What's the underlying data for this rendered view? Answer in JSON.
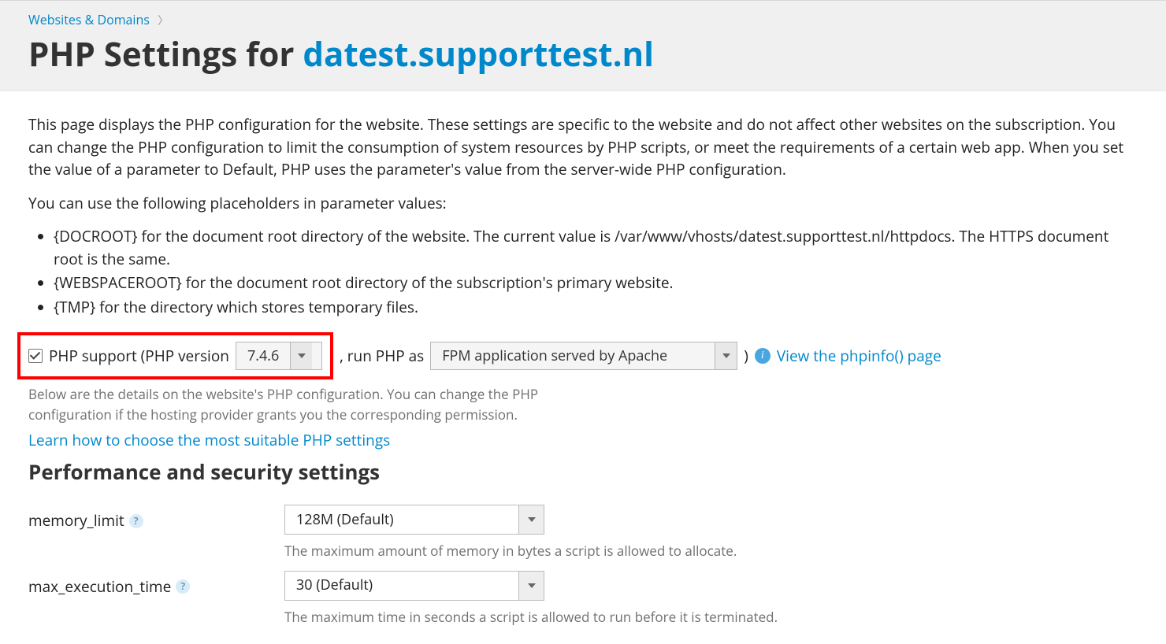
{
  "breadcrumb": {
    "parent": "Websites & Domains"
  },
  "title": {
    "prefix": "PHP Settings for ",
    "domain": "datest.supporttest.nl"
  },
  "intro": {
    "para1": "This page displays the PHP configuration for the website. These settings are specific to the website and do not affect other websites on the subscription. You can change the PHP configuration to limit the consumption of system resources by PHP scripts, or meet the requirements of a certain web app. When you set the value of a parameter to Default, PHP uses the parameter's value from the server-wide PHP configuration.",
    "para2": "You can use the following placeholders in parameter values:",
    "placeholders": [
      "{DOCROOT} for the document root directory of the website. The current value is /var/www/vhosts/datest.supporttest.nl/httpdocs. The HTTPS document root is the same.",
      "{WEBSPACEROOT} for the document root directory of the subscription's primary website.",
      "{TMP} for the directory which stores temporary files."
    ]
  },
  "php_support": {
    "checkbox_label_prefix": "PHP support (PHP version",
    "version": "7.4.6",
    "mid_text": ", run PHP as",
    "handler": "FPM application served by Apache",
    "closing": ")",
    "phpinfo_link": "View the phpinfo() page",
    "below_hint": "Below are the details on the website's PHP configuration. You can change the PHP configuration if the hosting provider grants you the corresponding permission.",
    "learn_link": "Learn how to choose the most suitable PHP settings"
  },
  "section": {
    "title": "Performance and security settings"
  },
  "fields": {
    "memory_limit": {
      "label": "memory_limit",
      "value": "128M (Default)",
      "hint": "The maximum amount of memory in bytes a script is allowed to allocate."
    },
    "max_execution_time": {
      "label": "max_execution_time",
      "value": "30 (Default)",
      "hint": "The maximum time in seconds a script is allowed to run before it is terminated."
    }
  }
}
